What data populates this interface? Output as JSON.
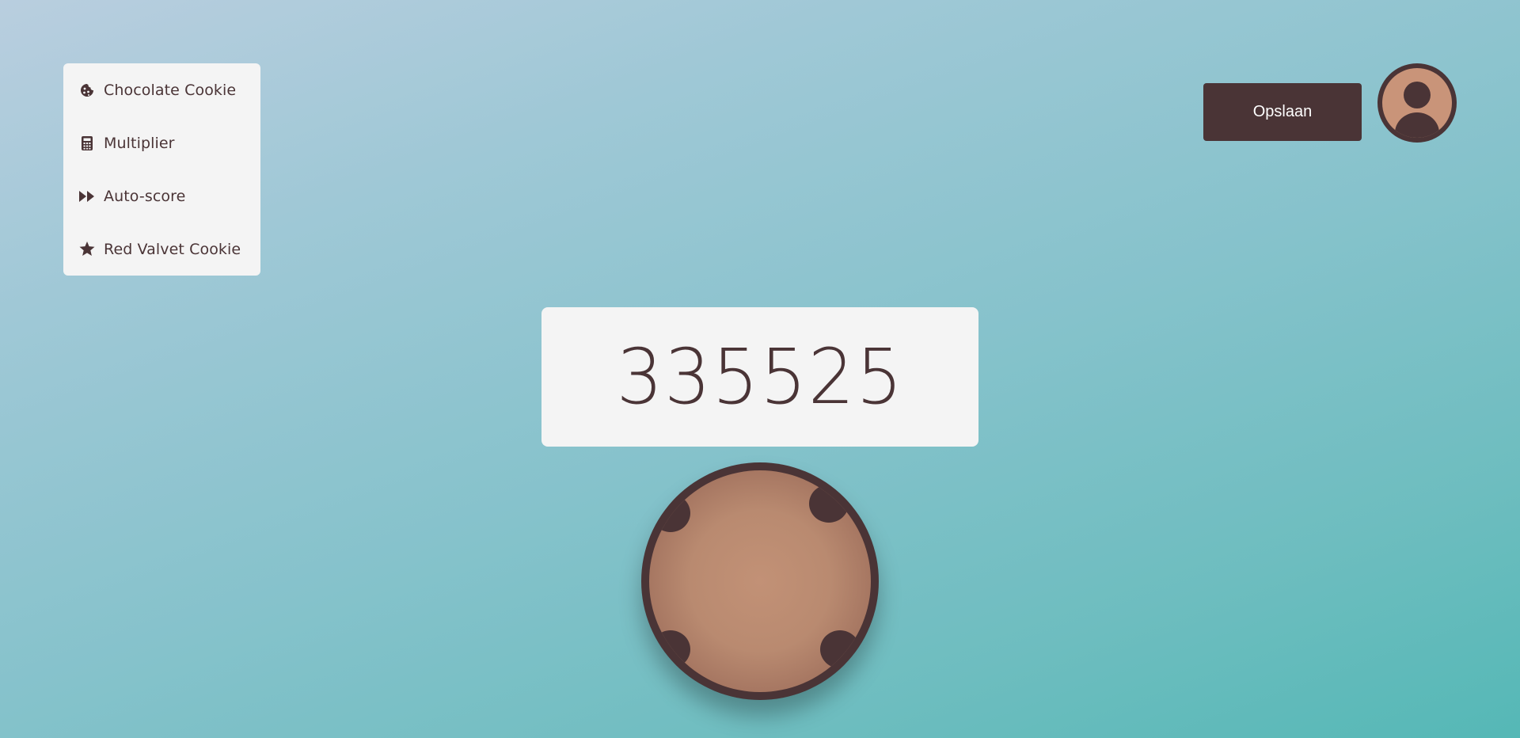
{
  "menu": {
    "items": [
      {
        "label": "Chocolate Cookie",
        "icon": "cookie-icon"
      },
      {
        "label": "Multiplier",
        "icon": "calculator-icon"
      },
      {
        "label": "Auto-score",
        "icon": "fast-forward-icon"
      },
      {
        "label": "Red Valvet Cookie",
        "icon": "star-icon"
      }
    ]
  },
  "header": {
    "save_label": "Opslaan",
    "avatar_icon": "user-icon"
  },
  "score": {
    "value": "335525"
  },
  "cookie": {
    "icon": "cookie-clicker-icon"
  },
  "colors": {
    "accent": "#4a3436",
    "panel": "#f4f4f4",
    "cookie": "#c29176",
    "avatar": "#c99479"
  }
}
